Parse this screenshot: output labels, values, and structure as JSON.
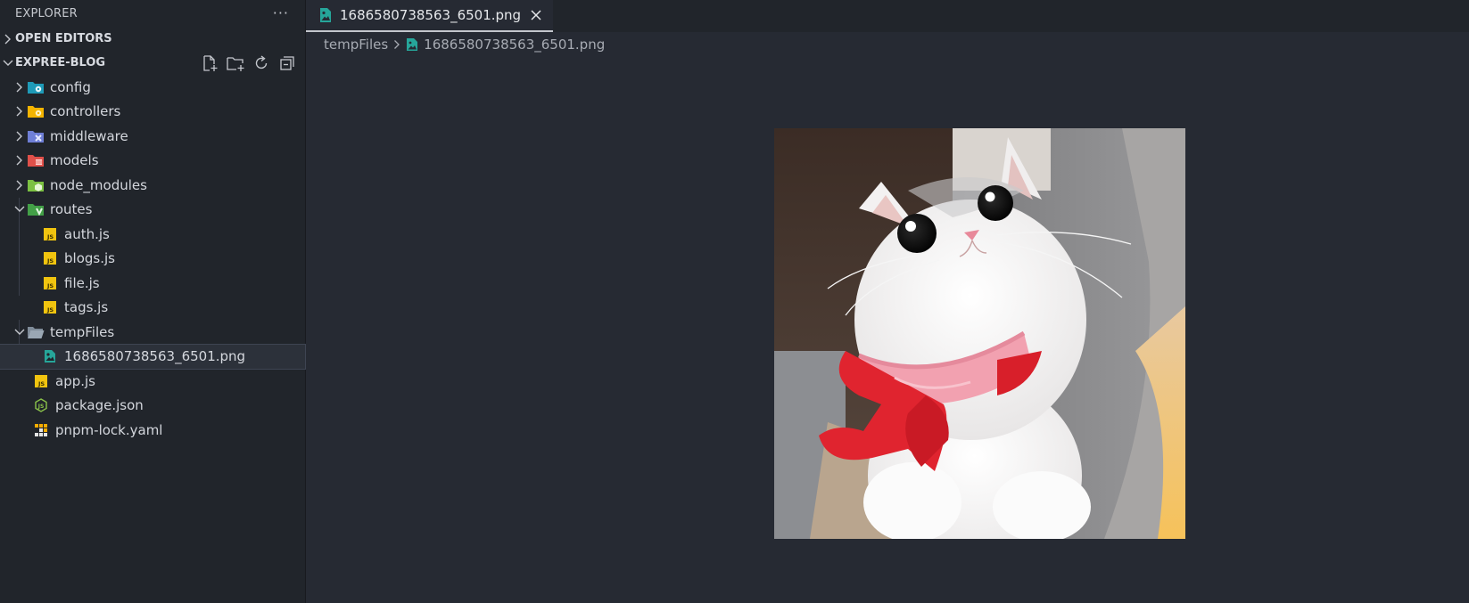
{
  "explorer": {
    "title": "EXPLORER",
    "more_label": "···"
  },
  "open_editors": {
    "label": "OPEN EDITORS"
  },
  "project": {
    "label": "EXPREE-BLOG",
    "actions": [
      "new-file-icon",
      "new-folder-icon",
      "refresh-icon",
      "collapse-all-icon"
    ]
  },
  "tree": {
    "config": "config",
    "controllers": "controllers",
    "middleware": "middleware",
    "models": "models",
    "node_modules": "node_modules",
    "routes": "routes",
    "auth": "auth.js",
    "blogs": "blogs.js",
    "file": "file.js",
    "tags": "tags.js",
    "tempFiles": "tempFiles",
    "png": "1686580738563_6501.png",
    "app": "app.js",
    "package": "package.json",
    "lock": "pnpm-lock.yaml"
  },
  "tab": {
    "label": "1686580738563_6501.png"
  },
  "breadcrumb": {
    "folder": "tempFiles",
    "file": "1686580738563_6501.png"
  },
  "colors": {
    "sidebar_bg": "#21252b",
    "editor_bg": "#262a33",
    "js_icon": "#f1c40f",
    "image_icon": "#26a69a"
  }
}
